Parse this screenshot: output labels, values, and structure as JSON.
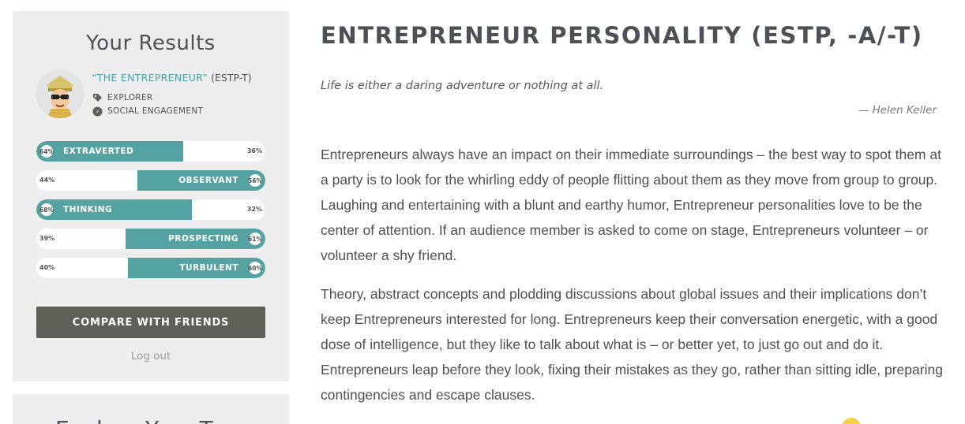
{
  "sidebar": {
    "title": "Your Results",
    "type_name": "“THE ENTREPRENEUR”",
    "type_code": "(ESTP-T)",
    "role": "EXPLORER",
    "strategy": "SOCIAL ENGAGEMENT",
    "traits": [
      {
        "name": "EXTRAVERTED",
        "percent": "64%",
        "other_percent": "36%",
        "side": "left",
        "value": 64
      },
      {
        "name": "OBSERVANT",
        "percent": "56%",
        "other_percent": "44%",
        "side": "right",
        "value": 56
      },
      {
        "name": "THINKING",
        "percent": "68%",
        "other_percent": "32%",
        "side": "left",
        "value": 68
      },
      {
        "name": "PROSPECTING",
        "percent": "61%",
        "other_percent": "39%",
        "side": "right",
        "value": 61
      },
      {
        "name": "TURBULENT",
        "percent": "60%",
        "other_percent": "40%",
        "side": "right",
        "value": 60
      }
    ],
    "compare_button": "COMPARE WITH FRIENDS",
    "logout": "Log out",
    "next_card_title": "Explore Your Type",
    "accent_color": "#55a2a2",
    "button_color": "#5f5f57"
  },
  "main": {
    "title": "ENTREPRENEUR PERSONALITY (ESTP, -A/-T)",
    "quote": "Life is either a daring adventure or nothing at all.",
    "quote_author": "— Helen Keller",
    "paragraphs": [
      "Entrepreneurs always have an impact on their immediate surroundings – the best way to spot them at a party is to look for the whirling eddy of people flitting about them as they move from group to group. Laughing and entertaining with a blunt and earthy humor, Entrepreneur personalities love to be the center of attention. If an audience member is asked to come on stage, Entrepreneurs volunteer – or volunteer a shy friend.",
      "Theory, abstract concepts and plodding discussions about global issues and their implications don’t keep Entrepreneurs interested for long. Entrepreneurs keep their conversation energetic, with a good dose of intelligence, but they like to talk about what is – or better yet, to just go out and do it. Entrepreneurs leap before they look, fixing their mistakes as they go, rather than sitting idle, preparing contingencies and escape clauses."
    ]
  }
}
